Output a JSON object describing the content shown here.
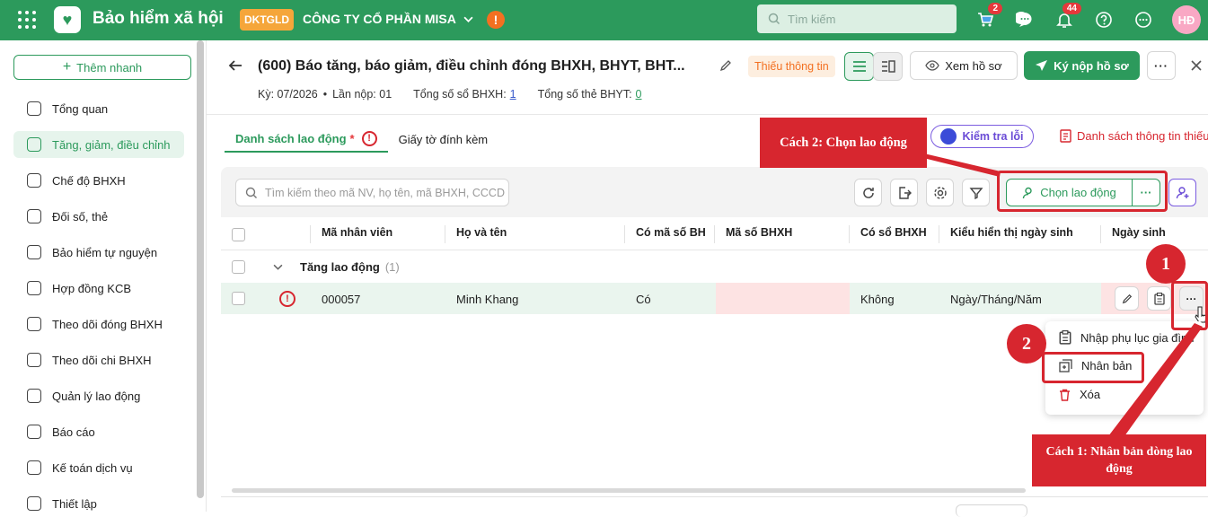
{
  "app": {
    "title": "Bảo hiểm xã hội",
    "company_badge": "DKTGLD",
    "company": "CÔNG TY CỔ PHẦN MISA",
    "search_placeholder": "Tìm kiếm",
    "cart_count": "2",
    "bell_count": "44",
    "avatar": "HĐ"
  },
  "sidebar": {
    "quick_add": "Thêm nhanh",
    "items": [
      {
        "label": "Tổng quan",
        "icon": "home-icon"
      },
      {
        "label": "Tăng, giảm, điều chỉnh",
        "icon": "user-up-icon",
        "active": true
      },
      {
        "label": "Chế độ BHXH",
        "icon": "shield-icon"
      },
      {
        "label": "Đối số, thẻ",
        "icon": "copy-icon"
      },
      {
        "label": "Bảo hiểm tự nguyện",
        "icon": "shield-check-icon"
      },
      {
        "label": "Hợp đồng KCB",
        "icon": "contract-icon"
      },
      {
        "label": "Theo dõi đóng BHXH",
        "icon": "c12-doc-icon"
      },
      {
        "label": "Theo dõi chi BHXH",
        "icon": "doc-money-icon"
      },
      {
        "label": "Quản lý lao động",
        "icon": "users-icon"
      },
      {
        "label": "Báo cáo",
        "icon": "report-icon"
      },
      {
        "label": "Kế toán dịch vụ",
        "icon": "chart-icon"
      },
      {
        "label": "Thiết lập",
        "icon": "gear-icon"
      }
    ]
  },
  "header": {
    "title": "(600) Báo tăng, báo giảm, điều chỉnh đóng BHXH, BHYT, BHT...",
    "missing_tag": "Thiếu thông tin",
    "view_btn": "Xem hồ sơ",
    "submit_btn": "Ký nộp hồ sơ",
    "period_label": "Kỳ: 07/2026",
    "submit_count": "Lần nộp: 01",
    "bhxh_label": "Tổng số sổ BHXH:",
    "bhxh_value": "1",
    "bhyt_label": "Tổng số thẻ BHYT:",
    "bhyt_value": "0"
  },
  "tabs": {
    "t1": "Danh sách lao động",
    "t1_star": "*",
    "t2": "Giấy tờ đính kèm",
    "check_errors": "Kiểm tra lỗi",
    "missing_list": "Danh sách thông tin thiếu"
  },
  "toolbar": {
    "search_placeholder": "Tìm kiếm theo mã NV, họ tên, mã BHXH, CCCD",
    "choose_btn": "Chọn lao động"
  },
  "table": {
    "headers": [
      "Mã nhân viên",
      "Họ và tên",
      "Có mã số BH",
      "Mã số BHXH",
      "Có sổ BHXH",
      "Kiểu hiển thị ngày sinh",
      "Ngày sinh"
    ],
    "group": {
      "label": "Tăng lao động",
      "count": "(1)"
    },
    "rows": [
      {
        "code": "000057",
        "name": "Minh Khang",
        "has_code": "Có",
        "bhxh_code": "",
        "has_book": "Không",
        "dob_format": "Ngày/Tháng/Năm",
        "dob": ""
      }
    ]
  },
  "context_menu": {
    "item1": "Nhập phụ lục gia đình",
    "item2": "Nhân bản",
    "item3": "Xóa"
  },
  "annotations": {
    "cach2": "Cách 2: Chọn lao động",
    "cach1": "Cách 1: Nhân bản dòng lao động",
    "step1": "1",
    "step2": "2"
  },
  "colors": {
    "brand": "#2c9a5c",
    "annotation": "#d7262f"
  }
}
